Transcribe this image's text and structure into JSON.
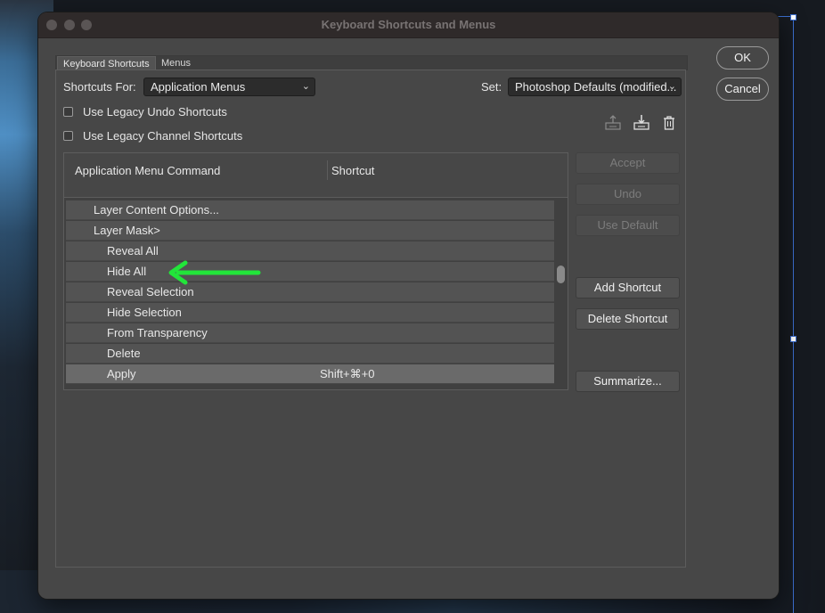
{
  "window": {
    "title": "Keyboard Shortcuts and Menus"
  },
  "tabs": [
    {
      "label": "Keyboard Shortcuts"
    },
    {
      "label": "Menus"
    }
  ],
  "shortcuts_for": {
    "label": "Shortcuts For:",
    "value": "Application Menus"
  },
  "set": {
    "label": "Set:",
    "value": "Photoshop Defaults (modified..."
  },
  "options": {
    "legacy_undo": {
      "label": "Use Legacy Undo Shortcuts",
      "checked": false
    },
    "legacy_channel": {
      "label": "Use Legacy Channel Shortcuts",
      "checked": false
    }
  },
  "icons": {
    "save": "save-set-icon",
    "save_as": "save-set-as-icon",
    "delete": "trash-icon"
  },
  "table": {
    "headers": [
      "Application Menu Command",
      "Shortcut"
    ],
    "rows": [
      {
        "command": "Layer Content Options...",
        "shortcut": "",
        "indent": 1
      },
      {
        "command": "Layer Mask>",
        "shortcut": "",
        "indent": 1
      },
      {
        "command": "Reveal All",
        "shortcut": "",
        "indent": 2
      },
      {
        "command": "Hide All",
        "shortcut": "",
        "indent": 2
      },
      {
        "command": "Reveal Selection",
        "shortcut": "",
        "indent": 2
      },
      {
        "command": "Hide Selection",
        "shortcut": "",
        "indent": 2
      },
      {
        "command": "From Transparency",
        "shortcut": "",
        "indent": 2
      },
      {
        "command": "Delete",
        "shortcut": "",
        "indent": 2
      },
      {
        "command": "Apply",
        "shortcut": "Shift+⌘+0",
        "indent": 2,
        "selected": true
      }
    ]
  },
  "buttons": {
    "accept": "Accept",
    "undo": "Undo",
    "use_default": "Use Default",
    "add_shortcut": "Add Shortcut",
    "delete_shortcut": "Delete Shortcut",
    "summarize": "Summarize...",
    "ok": "OK",
    "cancel": "Cancel"
  },
  "colors": {
    "annotation_arrow": "#22e53a",
    "guide": "#3c6fd0"
  }
}
